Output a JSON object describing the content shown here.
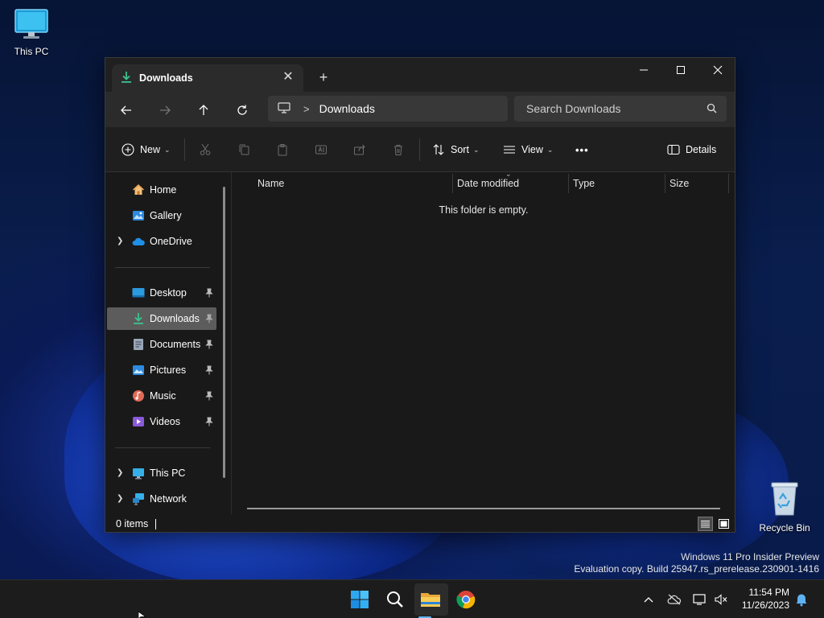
{
  "desktop": {
    "icons": [
      {
        "label": "This PC",
        "icon": "monitor-icon"
      },
      {
        "label": "Recycle Bin",
        "icon": "recycle-bin-icon"
      }
    ],
    "watermark": {
      "line1": "Windows 11 Pro Insider Preview",
      "line2": "Evaluation copy. Build 25947.rs_prerelease.230901-1416"
    }
  },
  "window": {
    "tab": {
      "title": "Downloads",
      "icon": "download-icon"
    },
    "new_tab_symbol": "+",
    "address": {
      "root_icon": "monitor-icon",
      "separator": ">",
      "crumb": "Downloads"
    },
    "search": {
      "placeholder": "Search Downloads"
    },
    "command_bar": {
      "new_label": "New",
      "sort_label": "Sort",
      "view_label": "View",
      "more_symbol": "•••",
      "details_label": "Details"
    },
    "sidebar": {
      "top_items": [
        {
          "label": "Home",
          "icon": "home-icon"
        },
        {
          "label": "Gallery",
          "icon": "gallery-icon"
        },
        {
          "label": "OneDrive",
          "icon": "onedrive-icon"
        }
      ],
      "pinned_items": [
        {
          "label": "Desktop",
          "icon": "desktop-folder-icon",
          "pinned": true
        },
        {
          "label": "Downloads",
          "icon": "download-icon",
          "pinned": true,
          "selected": true
        },
        {
          "label": "Documents",
          "icon": "documents-icon",
          "pinned": true
        },
        {
          "label": "Pictures",
          "icon": "pictures-icon",
          "pinned": true
        },
        {
          "label": "Music",
          "icon": "music-icon",
          "pinned": true
        },
        {
          "label": "Videos",
          "icon": "videos-icon",
          "pinned": true
        }
      ],
      "bottom_items": [
        {
          "label": "This PC",
          "icon": "monitor-icon"
        },
        {
          "label": "Network",
          "icon": "network-icon"
        }
      ]
    },
    "columns": [
      "Name",
      "Date modified",
      "Type",
      "Size"
    ],
    "empty_message": "This folder is empty.",
    "status": {
      "items_text": "0 items"
    }
  },
  "taskbar": {
    "clock": {
      "time": "11:54 PM",
      "date": "11/26/2023"
    },
    "pinned": [
      "start-icon",
      "search-icon",
      "file-explorer-icon",
      "chrome-icon"
    ]
  },
  "colors": {
    "accent": "#5fb2f2",
    "window_bg": "#191919",
    "toolbar_bg": "#2b2b2b",
    "selected_item": "#5c5c5c"
  }
}
